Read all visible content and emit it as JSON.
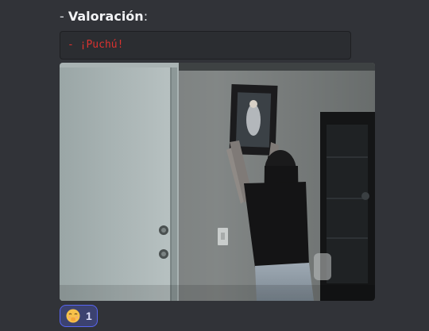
{
  "message": {
    "valoracion_prefix": "- ",
    "valoracion_label": "Valoración",
    "valoracion_colon": ":",
    "code_text": "- ¡Puchú!"
  },
  "attachment": {
    "type": "image"
  },
  "reaction": {
    "emoji_icon": "face-with-hand-over-mouth-icon",
    "count": "1",
    "accent_color": "#5865f2"
  }
}
